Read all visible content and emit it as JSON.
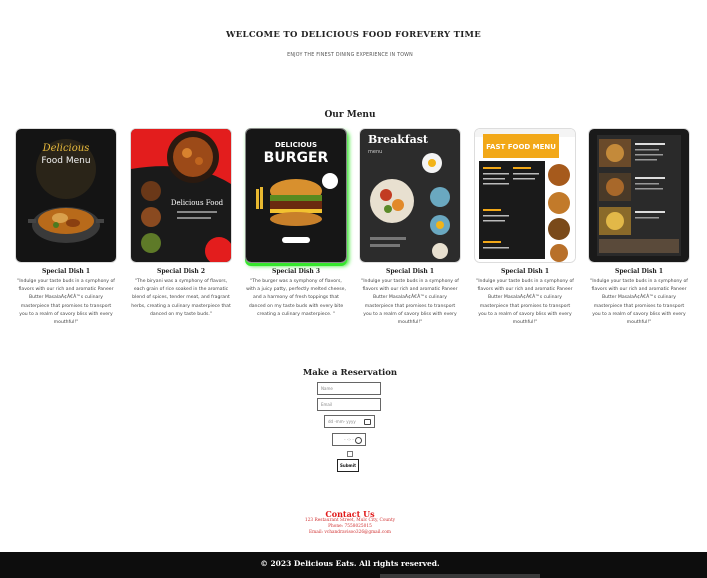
{
  "header": {
    "title": "WELCOME TO DELICIOUS FOOD FOREVERY TIME",
    "subtitle": "ENJOY THE FINEST DINING EXPERIENCE IN TOWN"
  },
  "menu": {
    "heading": "Our Menu",
    "cards": [
      {
        "name": "Special Dish 1",
        "image_text": "Delicious Food Menu",
        "description": "\"Indulge your taste buds in a symphony of flavors with our rich and aromatic Paneer Butter MasalaÃ¢Â€Â™s culinary masterpiece that promises to transport you to a realm of savory bliss with every mouthful!\""
      },
      {
        "name": "Special Dish 2",
        "image_text": "Delicious Food",
        "description": "\"The biryani was a symphony of flavors, each grain of rice soaked in the aromatic blend of spices, tender meat, and fragrant herbs, creating a culinary masterpiece that danced on my taste buds.\""
      },
      {
        "name": "Special Dish 3",
        "image_text": "DELICIOUS BURGER",
        "description": "\"The burger was a symphony of flavors, with a juicy patty, perfectly melted cheese, and a harmony of fresh toppings that danced on my taste buds with every bite creating a culinary masterpiece. \""
      },
      {
        "name": "Special Dish 1",
        "image_text": "Breakfast menu",
        "description": "\"Indulge your taste buds in a symphony of flavors with our rich and aromatic Paneer Butter MasalaÃ¢Â€Â™s culinary masterpiece that promises to transport you to a realm of savory bliss with every mouthful!\""
      },
      {
        "name": "Special Dish 1",
        "image_text": "FAST FOOD MENU",
        "description": "\"Indulge your taste buds in a symphony of flavors with our rich and aromatic Paneer Butter MasalaÃ¢Â€Â™s culinary masterpiece that promises to transport you to a realm of savory bliss with every mouthful!\""
      },
      {
        "name": "Special Dish 1",
        "image_text": "",
        "description": "\"Indulge your taste buds in a symphony of flavors with our rich and aromatic Paneer Butter MasalaÃ¢Â€Â™s culinary masterpiece that promises to transport you to a realm of savory bliss with every mouthful!\""
      }
    ]
  },
  "reservation": {
    "heading": "Make a Reservation",
    "name_placeholder": "Name",
    "email_placeholder": "Email",
    "date_placeholder": "dd -mm- yyyy",
    "time_placeholder": "- -:- -",
    "submit_label": "Submit"
  },
  "contact": {
    "heading": "Contact Us",
    "address": "123 Restaurant Street, Mulc City, County",
    "phone": "Phone: 7558025015",
    "email": "Email: vchandravisoo326@gmail.com"
  },
  "footer": {
    "copyright": "© 2023 Delicious Eats. All rights reserved."
  }
}
